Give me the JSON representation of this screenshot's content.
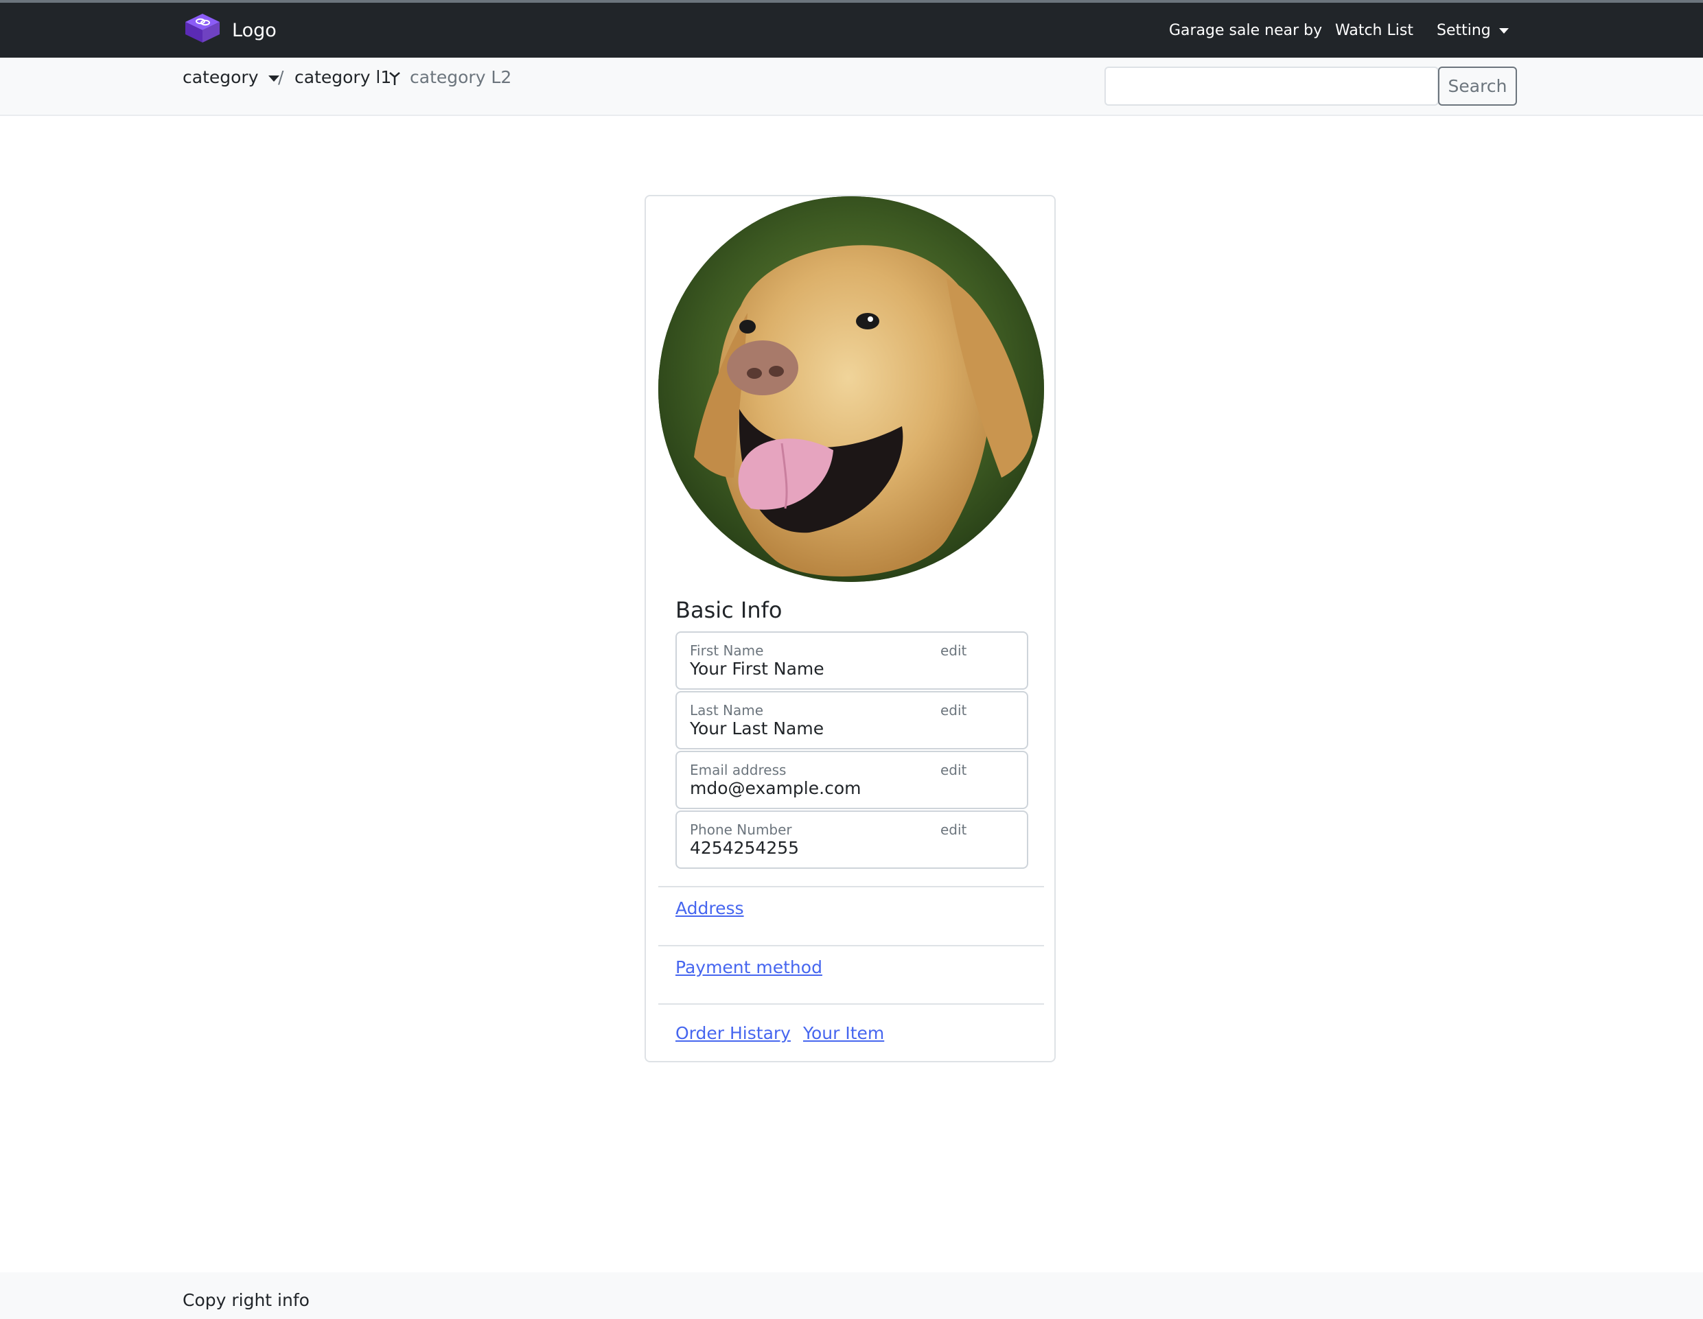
{
  "navbar": {
    "brand": "Logo",
    "links": {
      "garage_sale": "Garage sale near by",
      "watch_list": "Watch List",
      "setting": "Setting"
    }
  },
  "breadcrumb": {
    "category": "category",
    "separator": "/",
    "level1": "category l1",
    "level2": "category L2"
  },
  "search": {
    "value": "",
    "button": "Search"
  },
  "profile": {
    "section_title": "Basic Info",
    "fields": [
      {
        "label": "First Name",
        "value": "Your First Name",
        "action": "edit"
      },
      {
        "label": "Last Name",
        "value": "Your Last Name",
        "action": "edit"
      },
      {
        "label": "Email address",
        "value": "mdo@example.com",
        "action": "edit"
      },
      {
        "label": "Phone Number",
        "value": "4254254255",
        "action": "edit"
      }
    ],
    "links": {
      "address": "Address",
      "payment": "Payment method",
      "order_history": "Order Histary",
      "your_item": "Your Item"
    }
  },
  "footer": {
    "text": "Copy right info"
  },
  "colors": {
    "navbar_bg": "#212529",
    "link": "#4666ef",
    "brand_icon": "#6f42c1"
  }
}
